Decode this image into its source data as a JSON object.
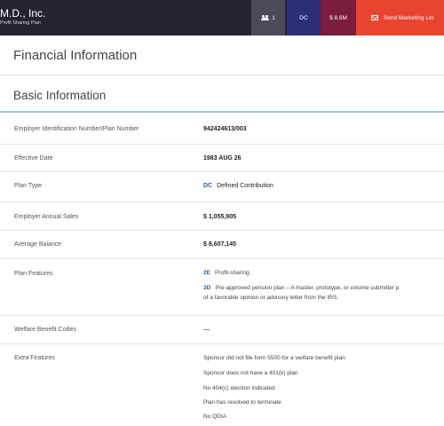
{
  "header": {
    "company_name": "M.D., Inc.",
    "plan_name": "Profit Sharing Plan",
    "users_count": "1",
    "plan_type_badge": "DC",
    "assets_badge": "$ 8.6M",
    "send_button_label": "Send Marketing Let"
  },
  "page": {
    "title": "Financial Information",
    "section_title": "Basic Information"
  },
  "rows": {
    "ein": {
      "label": "Employer Identification Number/Plan Number",
      "value": "942424613/003"
    },
    "effective_date": {
      "label": "Effective Date",
      "value": "1983 AUG 26"
    },
    "plan_type": {
      "label": "Plan Type",
      "code": "DC",
      "value": "Defined Contribution"
    },
    "annual_sales": {
      "label": "Employer Annual Sales",
      "value": "$ 1,055,905"
    },
    "average_balance": {
      "label": "Average Balance",
      "value": "$ 8,607,145"
    },
    "plan_features": {
      "label": "Plan Features",
      "items": [
        {
          "code": "2E",
          "text": "Profit-sharing."
        },
        {
          "code": "3D",
          "text": "Pre-approved pension plan – A master, prototype, or volume submitter p",
          "text2": "of a favorable opinion or advisory letter from the IRS."
        }
      ]
    },
    "welfare_codes": {
      "label": "Welfare Benefit Codes",
      "value": "—"
    },
    "extra_features": {
      "label": "Extra Features",
      "items": [
        "Sponsor did not file form 5500 for a welfare benefit plan",
        "Sponsor does not have a 401(k) plan",
        "No 404(c) election indicated",
        "Plan has resolved to terminate",
        "No QDIA"
      ]
    }
  },
  "colors": {
    "topbar": "#26232f",
    "users_badge": "#4b4a58",
    "dc_badge": "#2d2e75",
    "assets_badge": "#7a1c3e",
    "send_button": "#e84430",
    "code_blue": "#2a5db0",
    "section_underline": "#9ec3e6"
  },
  "icons": {
    "users": "users-icon",
    "send": "mail-icon"
  }
}
